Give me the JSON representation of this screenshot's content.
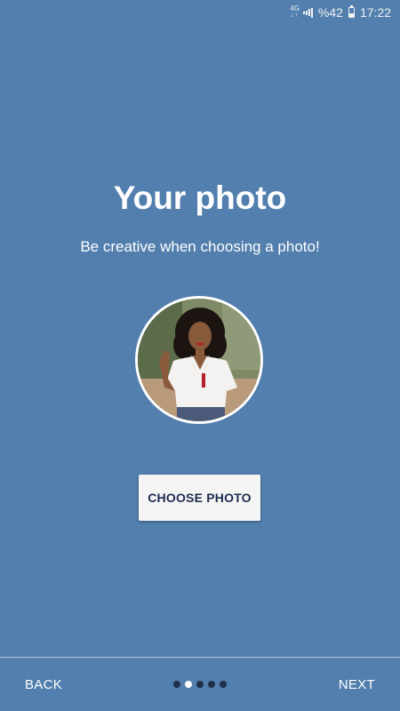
{
  "status_bar": {
    "network": "4G",
    "battery_text": "%42",
    "battery_level": 0.42,
    "time": "17:22"
  },
  "onboarding": {
    "title": "Your photo",
    "subtitle": "Be creative when choosing a photo!",
    "choose_button": "CHOOSE PHOTO"
  },
  "navigation": {
    "back_label": "BACK",
    "next_label": "NEXT",
    "page_count": 5,
    "current_page": 2
  },
  "colors": {
    "background": "#527fae",
    "button_text": "#1d2b4f",
    "dot_inactive": "#1f2f4a",
    "dot_active": "#ffffff"
  }
}
